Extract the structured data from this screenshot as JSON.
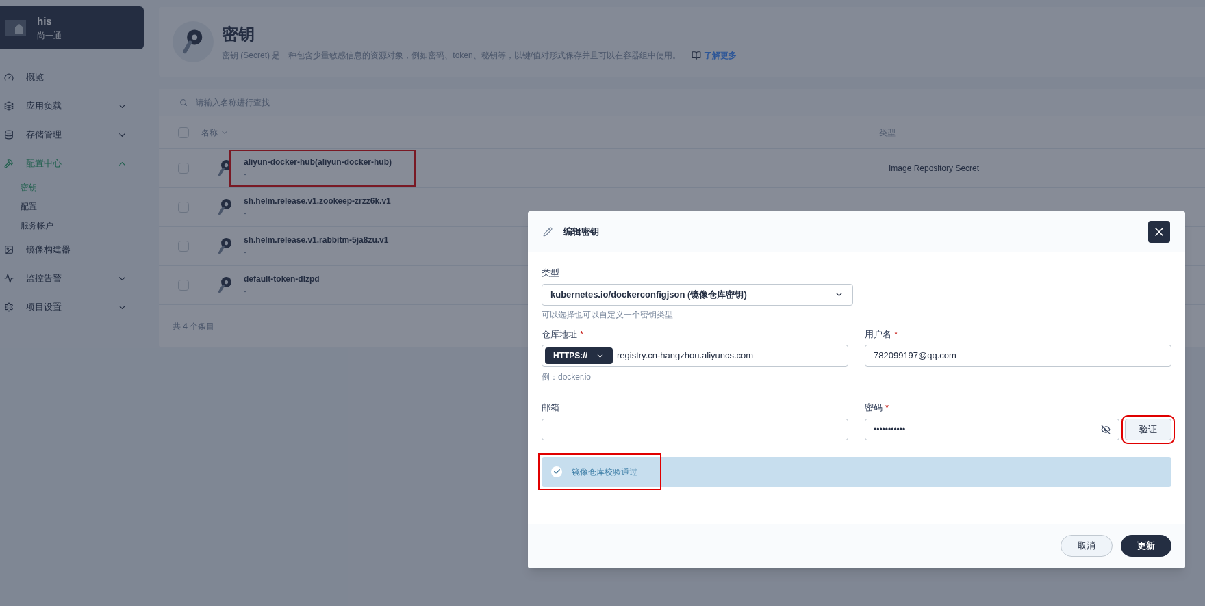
{
  "sidebar": {
    "workspace": {
      "name": "his",
      "subtitle": "尚一通"
    },
    "items": [
      {
        "label": "概览",
        "kind": "link",
        "selected": false
      },
      {
        "label": "应用负载",
        "kind": "group",
        "selected": false,
        "expanded": false
      },
      {
        "label": "存储管理",
        "kind": "group",
        "selected": false,
        "expanded": false
      },
      {
        "label": "配置中心",
        "kind": "group",
        "selected": true,
        "expanded": true,
        "children": [
          {
            "label": "密钥",
            "selected": true
          },
          {
            "label": "配置",
            "selected": false
          },
          {
            "label": "服务帐户",
            "selected": false
          }
        ]
      },
      {
        "label": "镜像构建器",
        "kind": "link",
        "selected": false
      },
      {
        "label": "监控告警",
        "kind": "group",
        "selected": false,
        "expanded": false
      },
      {
        "label": "项目设置",
        "kind": "group",
        "selected": false,
        "expanded": false
      }
    ]
  },
  "header": {
    "title": "密钥",
    "description": "密钥 (Secret) 是一种包含少量敏感信息的资源对象，例如密码、token、秘钥等，以键/值对形式保存并且可以在容器组中使用。",
    "link": "了解更多"
  },
  "search": {
    "placeholder": "请输入名称进行查找"
  },
  "table": {
    "columns": [
      "名称",
      "类型"
    ],
    "select_all_checked": false,
    "rows": [
      {
        "name": "aliyun-docker-hub(aliyun-docker-hub)",
        "description": "-",
        "type": "Image Repository Secret",
        "checked": false,
        "highlighted": true
      },
      {
        "name": "sh.helm.release.v1.zookeep-zrzz6k.v1",
        "description": "-",
        "checked": false,
        "highlighted": false
      },
      {
        "name": "sh.helm.release.v1.rabbitm-5ja8zu.v1",
        "description": "-",
        "checked": false,
        "highlighted": false
      },
      {
        "name": "default-token-dlzpd",
        "description": "-",
        "checked": false,
        "highlighted": false
      }
    ],
    "footer": "共 4 个条目"
  },
  "modal": {
    "title": "编辑密钥",
    "type_field": {
      "label": "类型",
      "value": "kubernetes.io/dockerconfigjson (镜像仓库密钥)",
      "hint": "可以选择也可以自定义一个密钥类型"
    },
    "registry_field": {
      "label": "仓库地址",
      "required": "*",
      "protocol": "HTTPS://",
      "value": "registry.cn-hangzhou.aliyuncs.com",
      "hint": "例：docker.io"
    },
    "username_field": {
      "label": "用户名",
      "required": "*",
      "value": "782099197@qq.com"
    },
    "email_field": {
      "label": "邮箱"
    },
    "password_field": {
      "label": "密码",
      "required": "*",
      "value": "•••••••••••",
      "verify_button": "验证",
      "verify_highlighted": true
    },
    "alert": {
      "text": "镜像仓库校验通过",
      "highlighted": true
    },
    "buttons": {
      "cancel": "取消",
      "submit": "更新"
    }
  }
}
